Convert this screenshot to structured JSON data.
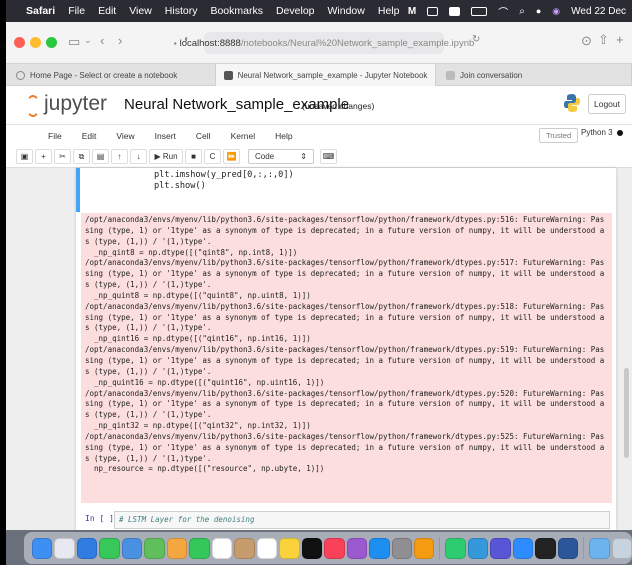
{
  "menubar": {
    "app": "Safari",
    "items": [
      "File",
      "Edit",
      "View",
      "History",
      "Bookmarks",
      "Develop",
      "Window",
      "Help"
    ],
    "clock": "Wed 22 Dec"
  },
  "browser": {
    "address_host": "localhost:8888",
    "address_path": "/notebooks/Neural%20Network_sample_example.ipynb",
    "tabs": [
      "Home Page - Select or create a notebook",
      "Neural Network_sample_example - Jupyter Notebook",
      "Join conversation"
    ]
  },
  "jupyter": {
    "logo": "jupyter",
    "title": "Neural Network_sample_example",
    "status": "(unsaved changes)",
    "logout": "Logout",
    "menu": [
      "File",
      "Edit",
      "View",
      "Insert",
      "Cell",
      "Kernel",
      "Help"
    ],
    "trusted": "Trusted",
    "kernel": "Python 3",
    "run_label": "Run",
    "cell_type": "Code"
  },
  "cell": {
    "code": [
      "plt.imshow(y_pred[0,:,:,0])",
      "plt.show()"
    ],
    "output": [
      "/opt/anaconda3/envs/myenv/lib/python3.6/site-packages/tensorflow/python/framework/dtypes.py:516: FutureWarning: Pas",
      "sing (type, 1) or '1type' as a synonym of type is deprecated; in a future version of numpy, it will be understood a",
      "s (type, (1,)) / '(1,)type'.",
      "  _np_qint8 = np.dtype([(\"qint8\", np.int8, 1)])",
      "/opt/anaconda3/envs/myenv/lib/python3.6/site-packages/tensorflow/python/framework/dtypes.py:517: FutureWarning: Pas",
      "sing (type, 1) or '1type' as a synonym of type is deprecated; in a future version of numpy, it will be understood a",
      "s (type, (1,)) / '(1,)type'.",
      "  _np_quint8 = np.dtype([(\"quint8\", np.uint8, 1)])",
      "/opt/anaconda3/envs/myenv/lib/python3.6/site-packages/tensorflow/python/framework/dtypes.py:518: FutureWarning: Pas",
      "sing (type, 1) or '1type' as a synonym of type is deprecated; in a future version of numpy, it will be understood a",
      "s (type, (1,)) / '(1,)type'.",
      "  _np_qint16 = np.dtype([(\"qint16\", np.int16, 1)])",
      "/opt/anaconda3/envs/myenv/lib/python3.6/site-packages/tensorflow/python/framework/dtypes.py:519: FutureWarning: Pas",
      "sing (type, 1) or '1type' as a synonym of type is deprecated; in a future version of numpy, it will be understood a",
      "s (type, (1,)) / '(1,)type'.",
      "  _np_quint16 = np.dtype([(\"quint16\", np.uint16, 1)])",
      "/opt/anaconda3/envs/myenv/lib/python3.6/site-packages/tensorflow/python/framework/dtypes.py:520: FutureWarning: Pas",
      "sing (type, 1) or '1type' as a synonym of type is deprecated; in a future version of numpy, it will be understood a",
      "s (type, (1,)) / '(1,)type'.",
      "  _np_qint32 = np.dtype([(\"qint32\", np.int32, 1)])",
      "/opt/anaconda3/envs/myenv/lib/python3.6/site-packages/tensorflow/python/framework/dtypes.py:525: FutureWarning: Pas",
      "sing (type, 1) or '1type' as a synonym of type is deprecated; in a future version of numpy, it will be understood a",
      "s (type, (1,)) / '(1,)type'.",
      "  np_resource = np.dtype([(\"resource\", np.ubyte, 1)])"
    ]
  },
  "next_cell": {
    "prompt": "In [ ]:",
    "code": "# LSTM Layer for the denoising"
  },
  "colors": {
    "error_bg": "#fcdede",
    "jupyter_orange": "#f37726",
    "selected_cell": "#42a5f5"
  },
  "dock_icons": [
    "finder",
    "launchpad",
    "safari",
    "messages",
    "mail",
    "maps",
    "photos",
    "facetime",
    "calendar",
    "contacts",
    "reminders",
    "notes",
    "tv",
    "music",
    "podcasts",
    "app-store",
    "system-preferences",
    "pages",
    "numbers",
    "keynote",
    "help",
    "zoom",
    "terminal",
    "word",
    "preview",
    "trash"
  ]
}
